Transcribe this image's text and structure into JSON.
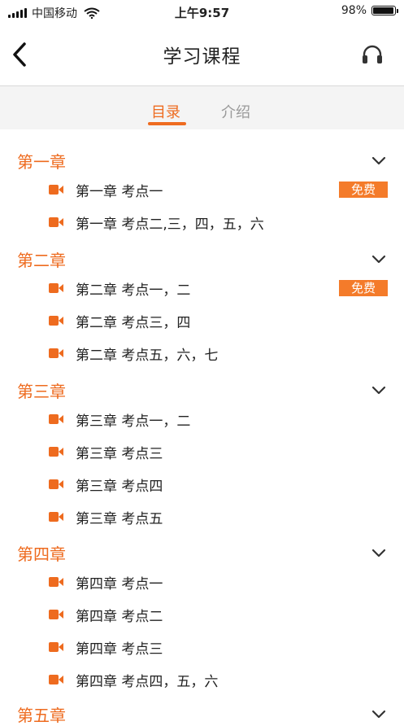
{
  "status": {
    "carrier": "中国移动",
    "time": "上午9:57",
    "battery": "98%",
    "battery_fraction": 0.98
  },
  "nav": {
    "title": "学习课程"
  },
  "tabs": [
    {
      "label": "目录",
      "active": true
    },
    {
      "label": "介绍",
      "active": false
    }
  ],
  "chapters": [
    {
      "title": "第一章",
      "lessons": [
        {
          "title": "第一章 考点一",
          "badge": "免费"
        },
        {
          "title": "第一章 考点二,三，四，五，六",
          "badge": ""
        }
      ]
    },
    {
      "title": "第二章",
      "lessons": [
        {
          "title": "第二章 考点一，二",
          "badge": "免费"
        },
        {
          "title": "第二章 考点三，四",
          "badge": ""
        },
        {
          "title": "第二章 考点五，六，七",
          "badge": ""
        }
      ]
    },
    {
      "title": "第三章",
      "lessons": [
        {
          "title": "第三章 考点一，二",
          "badge": ""
        },
        {
          "title": "第三章 考点三",
          "badge": ""
        },
        {
          "title": "第三章 考点四",
          "badge": ""
        },
        {
          "title": "第三章 考点五",
          "badge": ""
        }
      ]
    },
    {
      "title": "第四章",
      "lessons": [
        {
          "title": "第四章 考点一",
          "badge": ""
        },
        {
          "title": "第四章 考点二",
          "badge": ""
        },
        {
          "title": "第四章 考点三",
          "badge": ""
        },
        {
          "title": "第四章 考点四，五，六",
          "badge": ""
        }
      ]
    },
    {
      "title": "第五章",
      "lessons": []
    }
  ],
  "colors": {
    "accent": "#ee6b1f",
    "badge": "#f47b2a"
  },
  "icons": {
    "back": "chevron-left-icon",
    "headset": "headset-icon",
    "chapter_toggle": "chevron-down-icon",
    "lesson": "video-camera-icon"
  }
}
